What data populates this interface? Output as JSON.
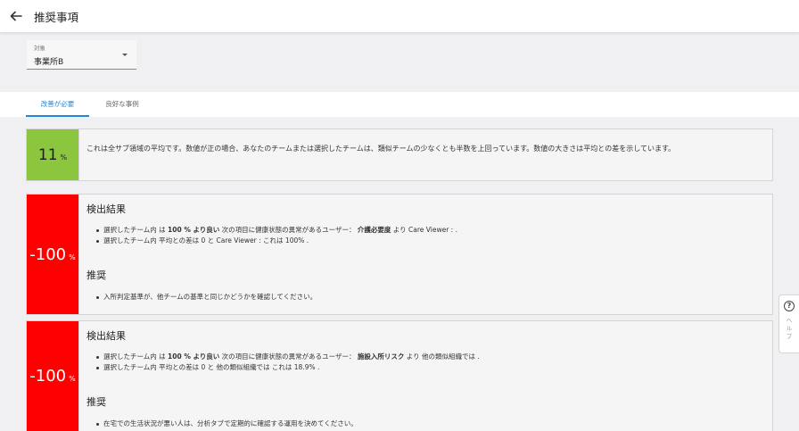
{
  "header": {
    "back_icon": "arrow-left-icon",
    "title": "推奨事項"
  },
  "filter": {
    "label": "対象",
    "value": "事業所B",
    "icon": "dropdown-arrow-icon"
  },
  "tabs": [
    {
      "label": "改善が必要",
      "active": true
    },
    {
      "label": "良好な事例",
      "active": false
    }
  ],
  "summary": {
    "value": "11",
    "unit": "%",
    "color": "#8cc63f",
    "text": "これは全サブ領域の平均です。数値が正の場合、あなたのチームまたは選択したチームは、類似チームの少なくとも半数を上回っています。数値の大きさは平均との差を示しています。"
  },
  "cards": [
    {
      "value": "-100",
      "unit": "%",
      "color": "#ff0000",
      "findings_title": "検出結果",
      "findings": [
        {
          "pre": "選択したチーム内 は ",
          "b1": "100 % より良い",
          "mid": " 次の項目に健康状態の異常があるユーザー： ",
          "b2": "介護必要度",
          "post": " より Care Viewer : ."
        },
        {
          "text": "選択したチーム内 平均との差は 0 と Care Viewer : これは 100% ."
        }
      ],
      "rec_title": "推奨",
      "recommendations": [
        "入所判定基準が、他チームの基準と同じかどうかを確認してください。"
      ]
    },
    {
      "value": "-100",
      "unit": "%",
      "color": "#ff0000",
      "findings_title": "検出結果",
      "findings": [
        {
          "pre": "選択したチーム内 は ",
          "b1": "100 % より良い",
          "mid": " 次の項目に健康状態の異常があるユーザー： ",
          "b2": "施設入所リスク",
          "post": " より 他の類似組織では ."
        },
        {
          "text": "選択したチーム内 平均との差は 0 と 他の類似組織では これは 18.9% ."
        }
      ],
      "rec_title": "推奨",
      "recommendations": [
        "在宅での生活状況が悪い人は、分析タブで定期的に確認する運用を決めてください。"
      ]
    }
  ],
  "help": {
    "icon": "question-circle-icon",
    "label": "ヘルプ"
  }
}
